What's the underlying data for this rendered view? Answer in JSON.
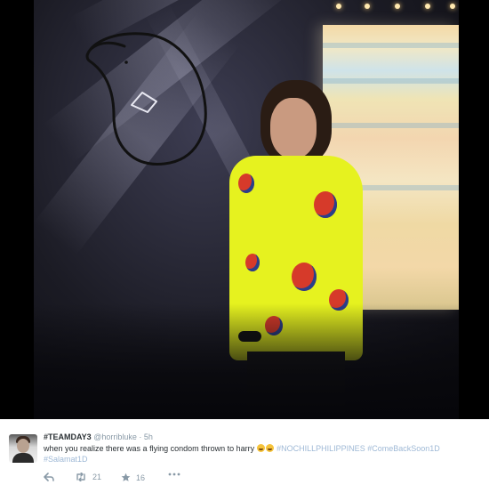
{
  "tweet": {
    "display_name": "#TEAMDAY3",
    "handle": "@horribluke",
    "separator": "·",
    "time": "5h",
    "text_prefix": "when you realize there was a flying condom thrown to harry",
    "emojis": [
      "face-with-tears-of-joy",
      "face-with-tears-of-joy"
    ],
    "hashtags": [
      "#NOCHILLPHILIPPINES",
      "#ComeBackSoon1D",
      "#Salamat1D"
    ],
    "retweet_count": "21",
    "favorite_count": "16"
  },
  "icons": {
    "reply": "reply-icon",
    "retweet": "retweet-icon",
    "favorite": "star-icon",
    "more": "more-icon"
  },
  "colors": {
    "hashtag": "#9fb9d6",
    "meta": "#8899a6",
    "text": "#292f33",
    "shirt": "#e6f21f"
  }
}
